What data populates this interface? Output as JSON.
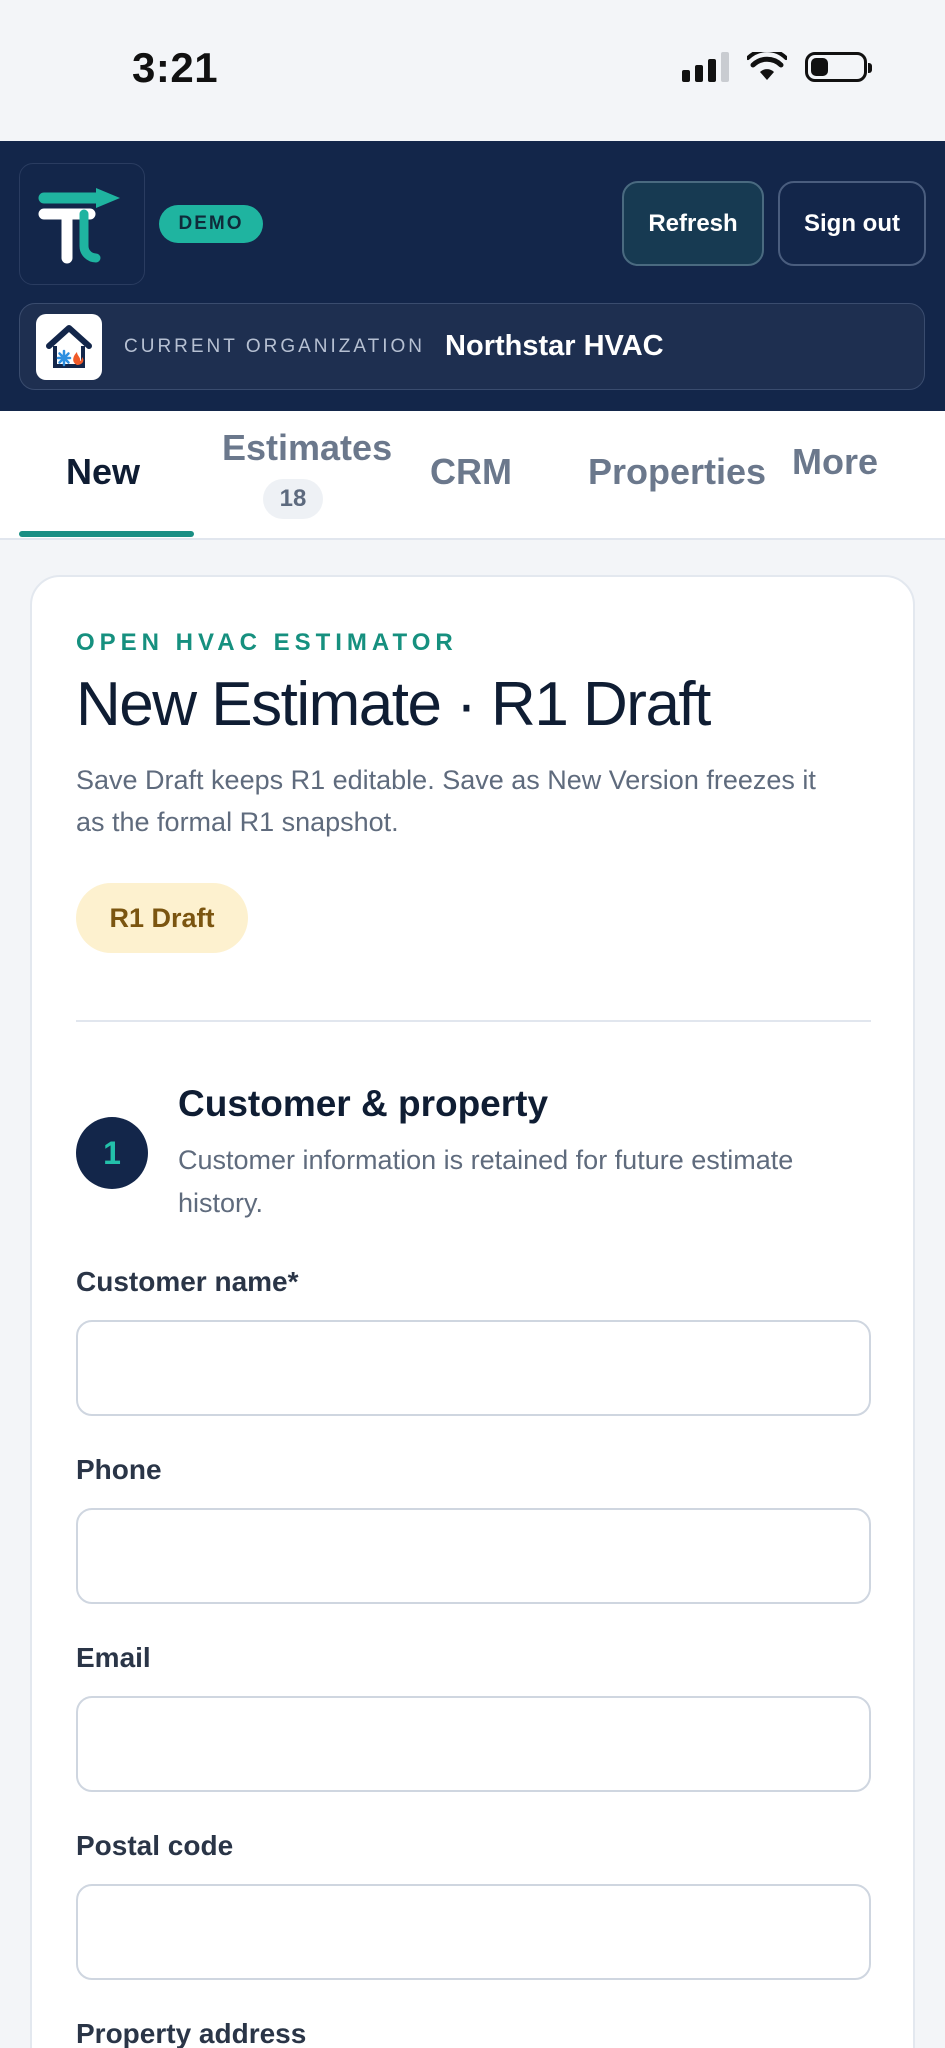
{
  "status_bar": {
    "time": "3:21"
  },
  "header": {
    "demo_label": "DEMO",
    "refresh_label": "Refresh",
    "signout_label": "Sign out",
    "org_label": "CURRENT ORGANIZATION",
    "org_name": "Northstar HVAC"
  },
  "tabs": {
    "new": "New",
    "estimates": "Estimates",
    "estimates_count": "18",
    "crm": "CRM",
    "properties": "Properties",
    "more": "More"
  },
  "card": {
    "eyebrow": "OPEN HVAC ESTIMATOR",
    "title": "New Estimate · R1 Draft",
    "description": "Save Draft keeps R1 editable. Save as New Version freezes it as the formal R1 snapshot.",
    "badge": "R1 Draft"
  },
  "section": {
    "number": "1",
    "title": "Customer & property",
    "description": "Customer information is retained for future estimate history."
  },
  "fields": {
    "customer_name": {
      "label": "Customer name*",
      "value": ""
    },
    "phone": {
      "label": "Phone",
      "value": ""
    },
    "email": {
      "label": "Email",
      "value": ""
    },
    "postal_code": {
      "label": "Postal code",
      "value": ""
    },
    "property_address": {
      "label": "Property address"
    }
  },
  "colors": {
    "header_bg": "#13264a",
    "accent_teal": "#1a8f84",
    "badge_bg": "#fdf1cf"
  }
}
